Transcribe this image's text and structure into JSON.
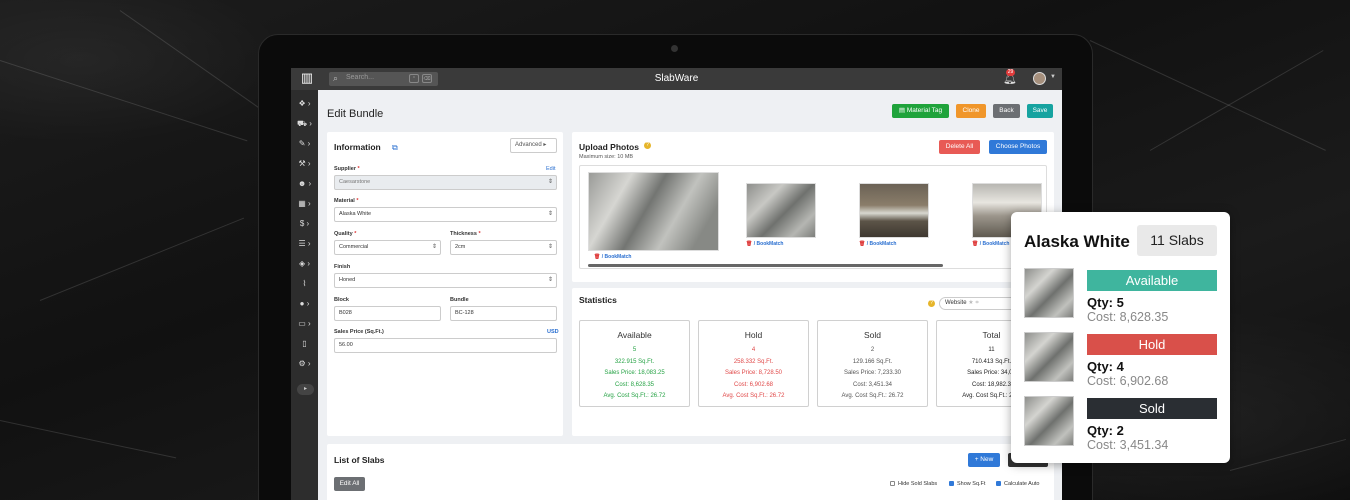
{
  "app": {
    "title": "SlabWare",
    "search_placeholder": "Search...",
    "notification_count": "29"
  },
  "page": {
    "title": "Edit Bundle",
    "actions": {
      "material_tag": "Material Tag",
      "clone": "Clone",
      "back": "Back",
      "save": "Save"
    }
  },
  "sidebar": {
    "icons": [
      "layers-icon",
      "cart-icon",
      "brush-icon",
      "hammer-icon",
      "users-icon",
      "archive-icon",
      "dollar-icon",
      "list-icon",
      "box-icon",
      "chart-icon",
      "user-icon",
      "laptop-icon",
      "mobile-icon",
      "gears-icon"
    ]
  },
  "information": {
    "title": "Information",
    "advanced_label": "Advanced",
    "supplier_label": "Supplier",
    "supplier_value": "Caesarstone",
    "supplier_edit": "Edit",
    "material_label": "Material",
    "material_value": "Alaska White",
    "quality_label": "Quality",
    "quality_value": "Commercial",
    "thickness_label": "Thickness",
    "thickness_value": "2cm",
    "finish_label": "Finish",
    "finish_value": "Honed",
    "block_label": "Block",
    "block_value": "B028",
    "bundle_label": "Bundle",
    "bundle_value": "BC-128",
    "price_label": "Sales Price (Sq.Ft.)",
    "price_currency": "USD",
    "price_value": "56.00"
  },
  "upload": {
    "title": "Upload Photos",
    "max_size": "Maximum size: 10 MB",
    "delete_all": "Delete All",
    "choose_photos": "Choose Photos",
    "bookmatch": "BookMatch",
    "separator": "/"
  },
  "statistics": {
    "title": "Statistics",
    "website_label": "Website",
    "boxes": [
      {
        "heading": "Available",
        "count": "5",
        "sqft": "322.915 Sq.Ft.",
        "sales": "Sales Price: 18,083.25",
        "cost": "Cost: 8,628.35",
        "avg": "Avg. Cost Sq.Ft.: 26.72"
      },
      {
        "heading": "Hold",
        "count": "4",
        "sqft": "258.332 Sq.Ft.",
        "sales": "Sales Price: 8,728.50",
        "cost": "Cost: 6,902.68",
        "avg": "Avg. Cost Sq.Ft.: 26.72"
      },
      {
        "heading": "Sold",
        "count": "2",
        "sqft": "129.166 Sq.Ft.",
        "sales": "Sales Price: 7,233.30",
        "cost": "Cost: 3,451.34",
        "avg": "Avg. Cost Sq.Ft.: 26.72"
      },
      {
        "heading": "Total",
        "count": "11",
        "sqft": "710.413 Sq.Ft.",
        "sales": "Sales Price: 34,04",
        "cost": "Cost: 18,982.3",
        "avg": "Avg. Cost Sq.Ft.: 26.7"
      }
    ]
  },
  "slabs": {
    "title": "List of Slabs",
    "new_label": "+ New",
    "edit_all": "Edit All",
    "hide_sold": "Hide Sold Slabs",
    "show_sqft": "Show Sq.Ft",
    "calc_auto": "Calculate Auto"
  },
  "card": {
    "name": "Alaska White",
    "count": "11 Slabs",
    "items": [
      {
        "status": "Available",
        "qty": "Qty: 5",
        "cost": "Cost: 8,628.35",
        "color": "#3fb59e"
      },
      {
        "status": "Hold",
        "qty": "Qty: 4",
        "cost": "Cost: 6,902.68",
        "color": "#d9504a"
      },
      {
        "status": "Sold",
        "qty": "Qty: 2",
        "cost": "Cost: 3,451.34",
        "color": "#2a2e33"
      }
    ]
  },
  "colors": {
    "green_btn": "#1fa33b",
    "orange_btn": "#f0962a",
    "gray_btn": "#6c6f73",
    "teal_btn": "#16a3a0",
    "red_btn": "#e85a55",
    "blue_btn": "#3079d8"
  }
}
